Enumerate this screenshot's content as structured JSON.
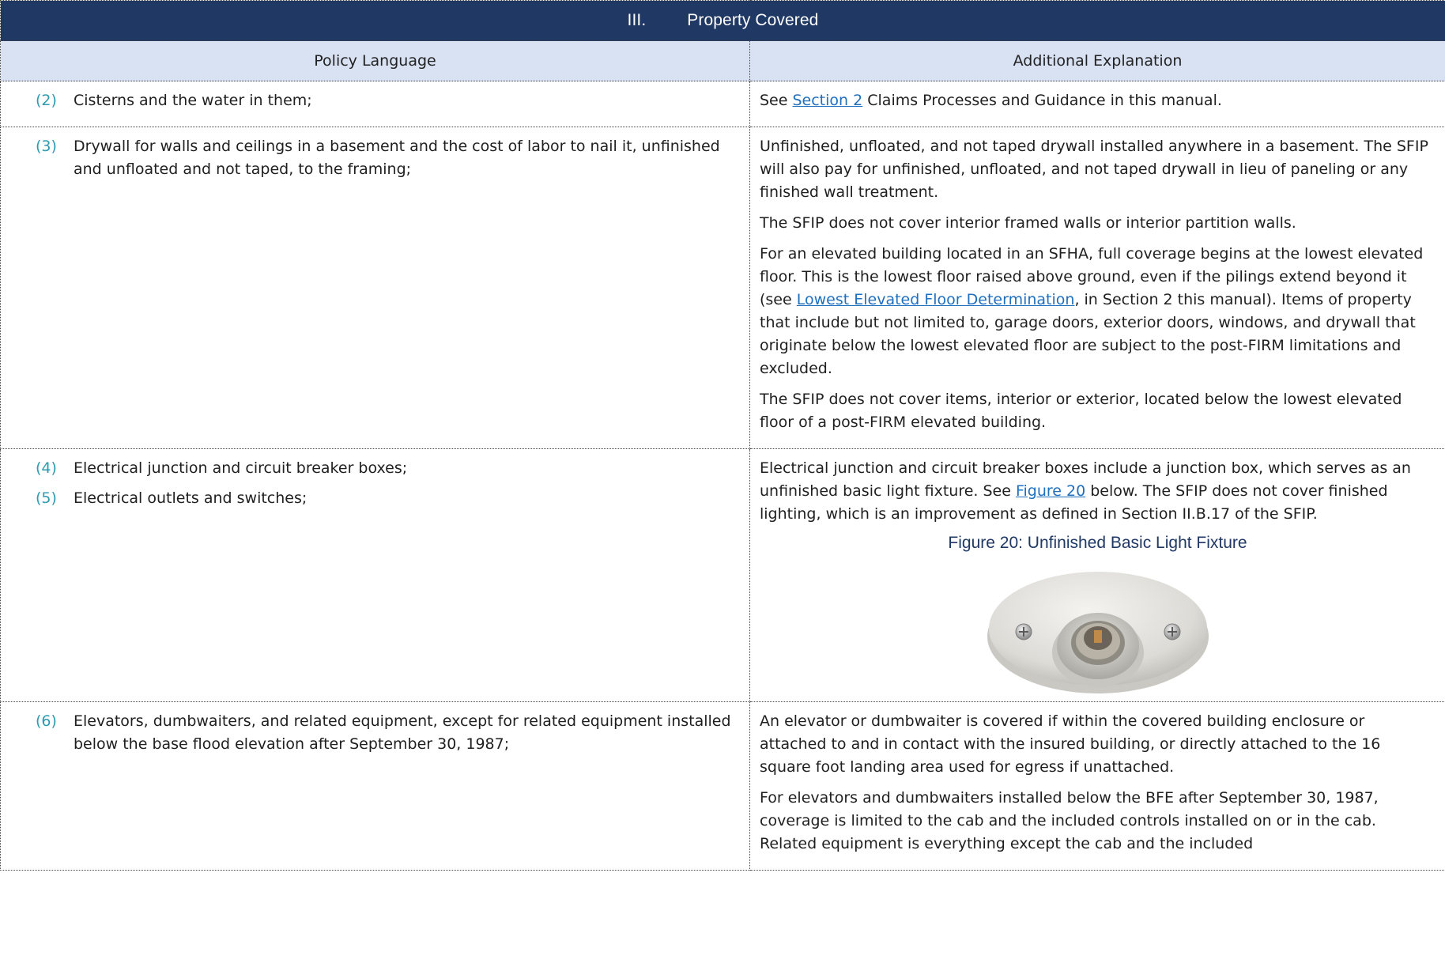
{
  "section": {
    "number": "III.",
    "title": "Property Covered"
  },
  "columns": {
    "left": "Policy Language",
    "right": "Additional Explanation"
  },
  "rows": [
    {
      "left": [
        {
          "marker": "(2)",
          "text": "Cisterns and the water in them;"
        }
      ],
      "right": {
        "p1_a": "See ",
        "p1_link": "Section 2",
        "p1_b": " Claims Processes and Guidance in this manual."
      }
    },
    {
      "left": [
        {
          "marker": "(3)",
          "text": "Drywall for walls and ceilings in a basement and the cost of labor to nail it, unfinished and unfloated and not taped, to the framing;"
        }
      ],
      "right": {
        "p1": "Unfinished, unfloated, and not taped drywall installed anywhere in a basement. The SFIP will also pay for unfinished, unfloated, and not taped drywall in lieu of paneling or any finished wall treatment.",
        "p2": "The SFIP does not cover interior framed walls or interior partition walls.",
        "p3_a": "For an elevated building located in an SFHA, full coverage begins at the lowest elevated floor. This is the lowest floor raised above ground, even if the pilings extend beyond it (see ",
        "p3_link": "Lowest Elevated Floor Determination",
        "p3_b": ", in Section 2 this manual). Items of property that include but not limited to, garage doors, exterior doors, windows, and drywall that originate below the lowest elevated floor are subject to the post-FIRM limitations and excluded.",
        "p4": "The SFIP does not cover items, interior or exterior, located below the lowest elevated floor of a post-FIRM elevated building."
      }
    },
    {
      "left": [
        {
          "marker": "(4)",
          "text": "Electrical junction and circuit breaker boxes;"
        },
        {
          "marker": "(5)",
          "text": "Electrical outlets and switches;"
        }
      ],
      "right": {
        "p1_a": "Electrical junction and circuit breaker boxes include a junction box, which serves as an unfinished basic light fixture. See ",
        "p1_link": "Figure 20",
        "p1_b": " below. The SFIP does not cover finished lighting, which is an improvement as defined in Section II.B.17 of the SFIP.",
        "figure_caption": "Figure 20: Unfinished Basic Light Fixture"
      }
    },
    {
      "left": [
        {
          "marker": "(6)",
          "text": "Elevators, dumbwaiters, and related equipment, except for related equipment installed below the base flood elevation after September 30, 1987;"
        }
      ],
      "right": {
        "p1": "An elevator or dumbwaiter is covered if within the covered building enclosure or attached to and in contact with the insured building, or directly attached to the 16 square foot landing area used for egress if unattached.",
        "p2": "For elevators and dumbwaiters installed below the BFE after September 30, 1987, coverage is limited to the cab and the included controls installed on or in the cab. Related equipment is everything except the cab and the included"
      }
    }
  ]
}
